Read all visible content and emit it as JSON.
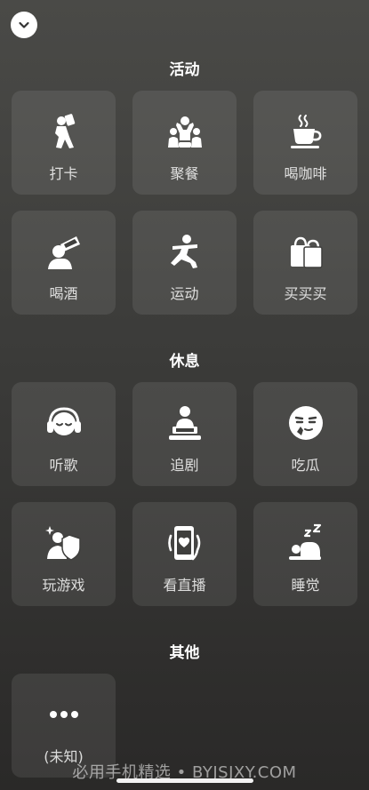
{
  "sections": {
    "activity": {
      "title": "活动",
      "items": [
        {
          "label": "打卡",
          "icon": "check-in-icon"
        },
        {
          "label": "聚餐",
          "icon": "dinner-gathering-icon"
        },
        {
          "label": "喝咖啡",
          "icon": "coffee-cup-icon"
        },
        {
          "label": "喝酒",
          "icon": "drinking-icon"
        },
        {
          "label": "运动",
          "icon": "exercise-icon"
        },
        {
          "label": "买买买",
          "icon": "shopping-bags-icon"
        }
      ]
    },
    "rest": {
      "title": "休息",
      "items": [
        {
          "label": "听歌",
          "icon": "headphones-icon"
        },
        {
          "label": "追剧",
          "icon": "watching-tv-icon"
        },
        {
          "label": "吃瓜",
          "icon": "gossip-face-icon"
        },
        {
          "label": "玩游戏",
          "icon": "game-icon"
        },
        {
          "label": "看直播",
          "icon": "live-stream-icon"
        },
        {
          "label": "睡觉",
          "icon": "sleep-icon"
        }
      ]
    },
    "other": {
      "title": "其他",
      "items": [
        {
          "label": "(未知)",
          "icon": "more-dots-icon"
        }
      ]
    }
  },
  "watermark": "必用手机精选 • BYJSJXY.COM"
}
